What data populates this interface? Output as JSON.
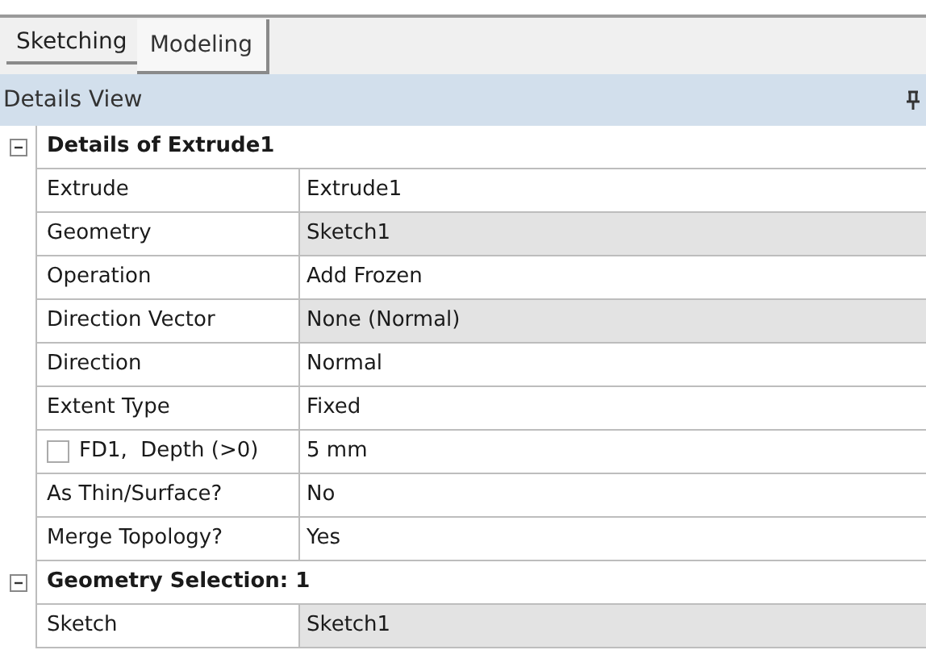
{
  "tabs": [
    {
      "label": "Sketching",
      "selected": false
    },
    {
      "label": "Modeling",
      "selected": true
    }
  ],
  "panel": {
    "title": "Details View"
  },
  "groups": [
    {
      "title": "Details of Extrude1",
      "expanded": true,
      "rows": [
        {
          "label": "Extrude",
          "value": "Extrude1",
          "readonly": false
        },
        {
          "label": "Geometry",
          "value": "Sketch1",
          "readonly": true
        },
        {
          "label": "Operation",
          "value": "Add Frozen",
          "readonly": false
        },
        {
          "label": "Direction Vector",
          "value": "None (Normal)",
          "readonly": true
        },
        {
          "label": "Direction",
          "value": "Normal",
          "readonly": false
        },
        {
          "label": "Extent Type",
          "value": "Fixed",
          "readonly": false
        },
        {
          "label": "FD1,  Depth (>0)",
          "value": "5 mm",
          "readonly": false,
          "checked": false
        },
        {
          "label": "As Thin/Surface?",
          "value": "No",
          "readonly": false
        },
        {
          "label": "Merge Topology?",
          "value": "Yes",
          "readonly": false
        }
      ]
    },
    {
      "title": "Geometry Selection: 1",
      "expanded": true,
      "rows": [
        {
          "label": "Sketch",
          "value": "Sketch1",
          "readonly": true
        }
      ]
    }
  ]
}
